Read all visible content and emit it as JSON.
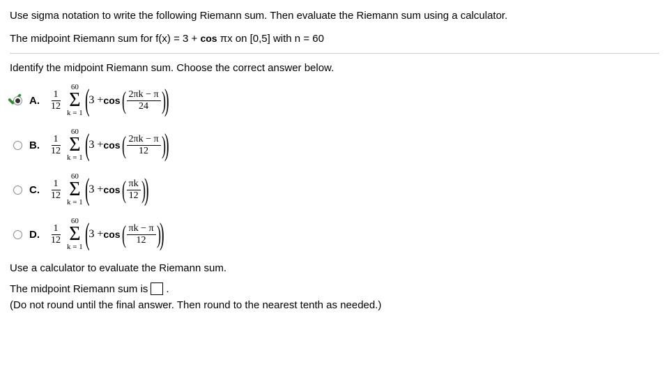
{
  "question": {
    "intro": "Use sigma notation to write the following Riemann sum. Then evaluate the Riemann sum using a calculator.",
    "problem_prefix": "The midpoint Riemann sum for f(x) = 3 + ",
    "problem_cos": "cos",
    "problem_suffix": " πx on [0,5] with n = 60",
    "identify": "Identify the midpoint Riemann sum. Choose the correct answer below."
  },
  "options": {
    "A": {
      "letter": "A.",
      "coef_num": "1",
      "coef_den": "12",
      "sigma_upper": "60",
      "sigma_lower": "k = 1",
      "inner_const": "3 + ",
      "cos": "cos",
      "arg_num": "2πk − π",
      "arg_den": "24",
      "selected": true,
      "correct": true
    },
    "B": {
      "letter": "B.",
      "coef_num": "1",
      "coef_den": "12",
      "sigma_upper": "60",
      "sigma_lower": "k = 1",
      "inner_const": "3 + ",
      "cos": "cos",
      "arg_num": "2πk − π",
      "arg_den": "12",
      "selected": false,
      "correct": false
    },
    "C": {
      "letter": "C.",
      "coef_num": "1",
      "coef_den": "12",
      "sigma_upper": "60",
      "sigma_lower": "k = 1",
      "inner_const": "3 + ",
      "cos": "cos",
      "arg_num": "πk",
      "arg_den": "12",
      "selected": false,
      "correct": false
    },
    "D": {
      "letter": "D.",
      "coef_num": "1",
      "coef_den": "12",
      "sigma_upper": "60",
      "sigma_lower": "k = 1",
      "inner_const": "3 + ",
      "cos": "cos",
      "arg_num": "πk − π",
      "arg_den": "12",
      "selected": false,
      "correct": false
    }
  },
  "eval": {
    "prompt": "Use a calculator to evaluate the Riemann sum.",
    "answer_prefix": "The midpoint Riemann sum is ",
    "answer_suffix": ".",
    "hint": "(Do not round until the final answer. Then round to the nearest tenth as needed.)"
  }
}
